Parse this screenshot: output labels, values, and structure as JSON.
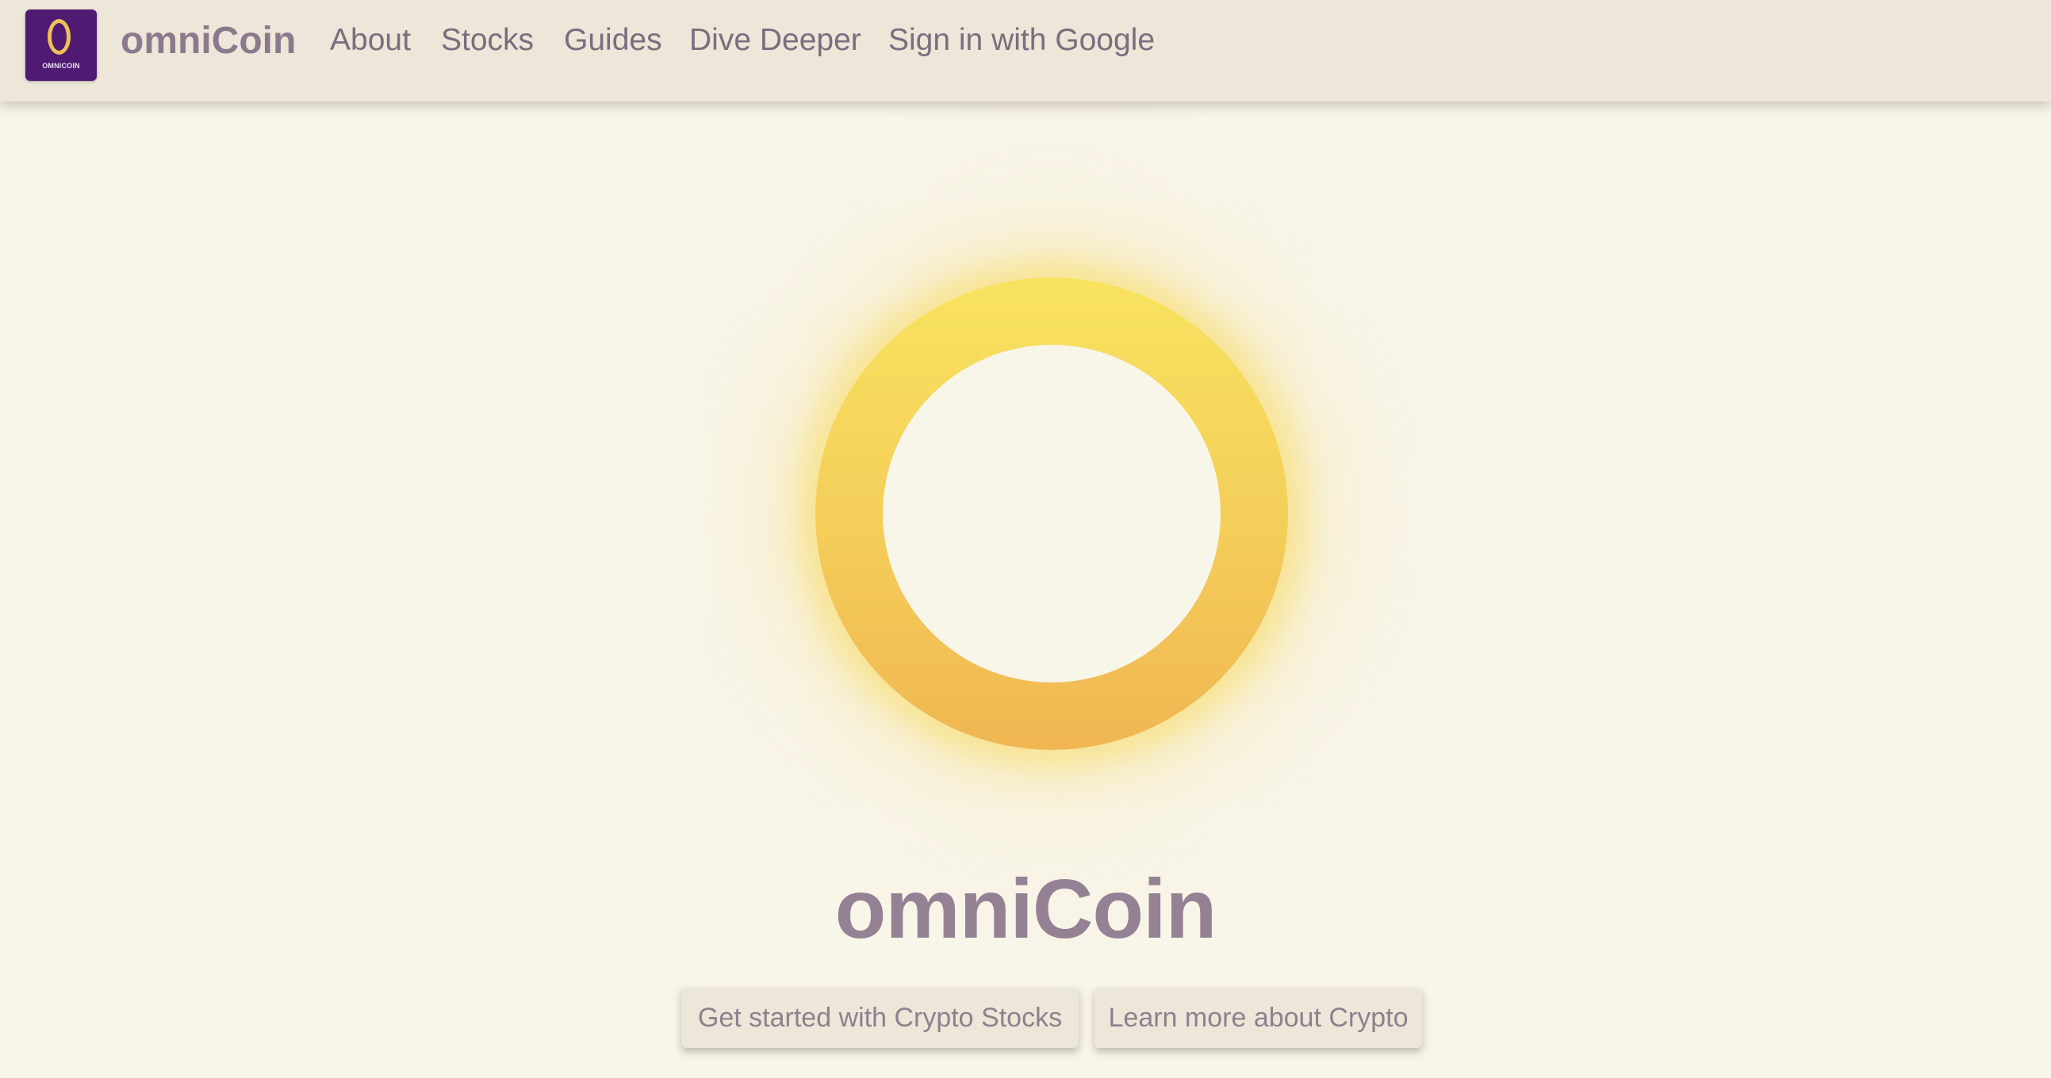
{
  "header": {
    "logo_text": "OMNICOIN",
    "brand": "omniCoin",
    "nav": [
      {
        "label": "About"
      },
      {
        "label": "Stocks"
      },
      {
        "label": "Guides"
      },
      {
        "label": "Dive Deeper"
      },
      {
        "label": "Sign in with Google"
      }
    ]
  },
  "hero": {
    "graphic": "gold-coin-ring-icon",
    "title": "omniCoin",
    "buttons": {
      "primary": "Get started with Crypto Stocks",
      "secondary": "Learn more about Crypto"
    }
  },
  "colors": {
    "background": "#f8f5e9",
    "navbar": "#ece7d9",
    "logo_bg": "#4f1b72",
    "coin_gold_top": "#f8e35f",
    "coin_gold_bottom": "#f0b652",
    "text": "#8c7a8c"
  }
}
